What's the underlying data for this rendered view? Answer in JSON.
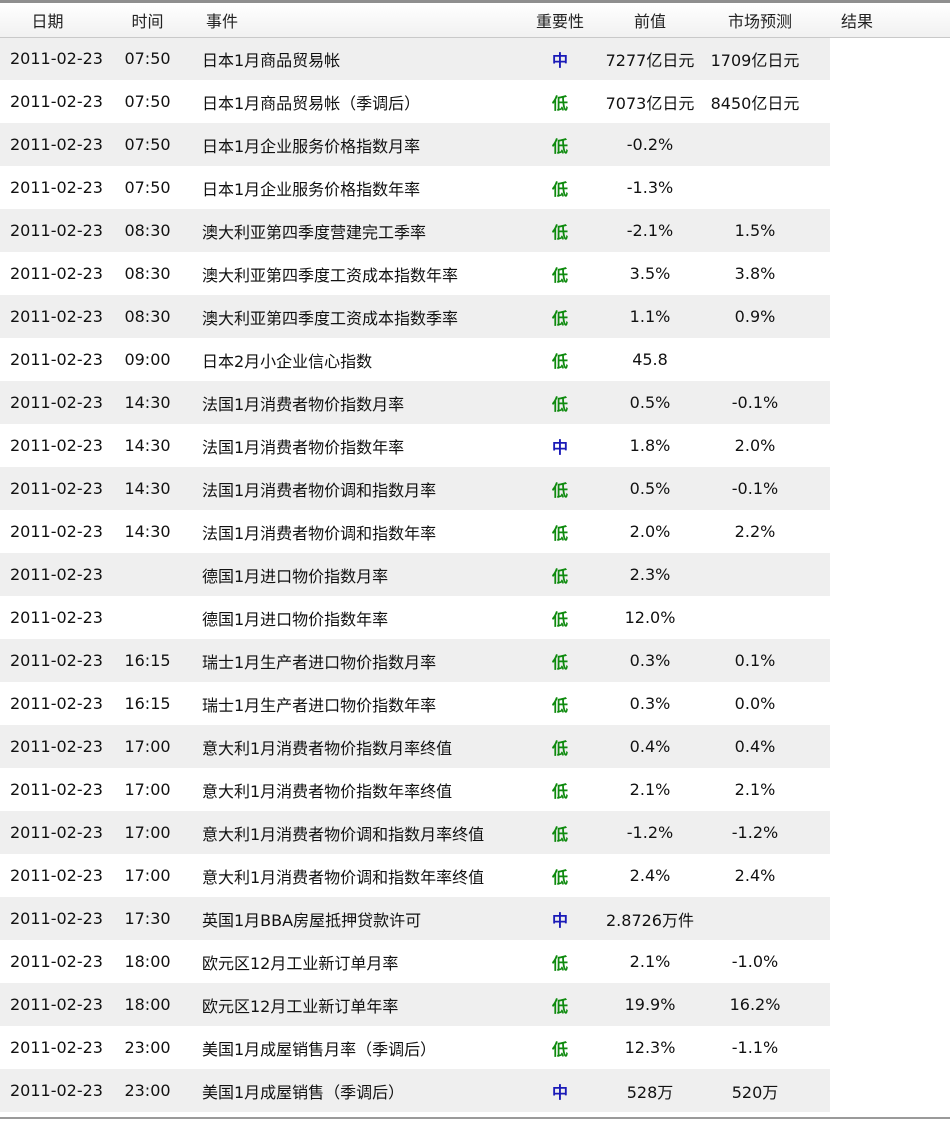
{
  "header": {
    "date": "日期",
    "time": "时间",
    "event": "事件",
    "importance": "重要性",
    "previous": "前值",
    "forecast": "市场预测",
    "result": "结果"
  },
  "colors": {
    "importance_mid": "#1a1ab8",
    "importance_low": "#0e8a0e",
    "row_shade": "#efefef"
  },
  "rows": [
    {
      "date": "2011-02-23",
      "time": "07:50",
      "event": "日本1月商品贸易帐",
      "importance": "中",
      "previous": "7277亿日元",
      "forecast": "1709亿日元",
      "result": ""
    },
    {
      "date": "2011-02-23",
      "time": "07:50",
      "event": "日本1月商品贸易帐（季调后）",
      "importance": "低",
      "previous": "7073亿日元",
      "forecast": "8450亿日元",
      "result": ""
    },
    {
      "date": "2011-02-23",
      "time": "07:50",
      "event": "日本1月企业服务价格指数月率",
      "importance": "低",
      "previous": "-0.2%",
      "forecast": "",
      "result": ""
    },
    {
      "date": "2011-02-23",
      "time": "07:50",
      "event": "日本1月企业服务价格指数年率",
      "importance": "低",
      "previous": "-1.3%",
      "forecast": "",
      "result": ""
    },
    {
      "date": "2011-02-23",
      "time": "08:30",
      "event": "澳大利亚第四季度营建完工季率",
      "importance": "低",
      "previous": "-2.1%",
      "forecast": "1.5%",
      "result": ""
    },
    {
      "date": "2011-02-23",
      "time": "08:30",
      "event": "澳大利亚第四季度工资成本指数年率",
      "importance": "低",
      "previous": "3.5%",
      "forecast": "3.8%",
      "result": ""
    },
    {
      "date": "2011-02-23",
      "time": "08:30",
      "event": "澳大利亚第四季度工资成本指数季率",
      "importance": "低",
      "previous": "1.1%",
      "forecast": "0.9%",
      "result": ""
    },
    {
      "date": "2011-02-23",
      "time": "09:00",
      "event": "日本2月小企业信心指数",
      "importance": "低",
      "previous": "45.8",
      "forecast": "",
      "result": ""
    },
    {
      "date": "2011-02-23",
      "time": "14:30",
      "event": "法国1月消费者物价指数月率",
      "importance": "低",
      "previous": "0.5%",
      "forecast": "-0.1%",
      "result": ""
    },
    {
      "date": "2011-02-23",
      "time": "14:30",
      "event": "法国1月消费者物价指数年率",
      "importance": "中",
      "previous": "1.8%",
      "forecast": "2.0%",
      "result": ""
    },
    {
      "date": "2011-02-23",
      "time": "14:30",
      "event": "法国1月消费者物价调和指数月率",
      "importance": "低",
      "previous": "0.5%",
      "forecast": "-0.1%",
      "result": ""
    },
    {
      "date": "2011-02-23",
      "time": "14:30",
      "event": "法国1月消费者物价调和指数年率",
      "importance": "低",
      "previous": "2.0%",
      "forecast": "2.2%",
      "result": ""
    },
    {
      "date": "2011-02-23",
      "time": "",
      "event": "德国1月进口物价指数月率",
      "importance": "低",
      "previous": "2.3%",
      "forecast": "",
      "result": ""
    },
    {
      "date": "2011-02-23",
      "time": "",
      "event": "德国1月进口物价指数年率",
      "importance": "低",
      "previous": "12.0%",
      "forecast": "",
      "result": ""
    },
    {
      "date": "2011-02-23",
      "time": "16:15",
      "event": "瑞士1月生产者进口物价指数月率",
      "importance": "低",
      "previous": "0.3%",
      "forecast": "0.1%",
      "result": ""
    },
    {
      "date": "2011-02-23",
      "time": "16:15",
      "event": "瑞士1月生产者进口物价指数年率",
      "importance": "低",
      "previous": "0.3%",
      "forecast": "0.0%",
      "result": ""
    },
    {
      "date": "2011-02-23",
      "time": "17:00",
      "event": "意大利1月消费者物价指数月率终值",
      "importance": "低",
      "previous": "0.4%",
      "forecast": "0.4%",
      "result": ""
    },
    {
      "date": "2011-02-23",
      "time": "17:00",
      "event": "意大利1月消费者物价指数年率终值",
      "importance": "低",
      "previous": "2.1%",
      "forecast": "2.1%",
      "result": ""
    },
    {
      "date": "2011-02-23",
      "time": "17:00",
      "event": "意大利1月消费者物价调和指数月率终值",
      "importance": "低",
      "previous": "-1.2%",
      "forecast": "-1.2%",
      "result": ""
    },
    {
      "date": "2011-02-23",
      "time": "17:00",
      "event": "意大利1月消费者物价调和指数年率终值",
      "importance": "低",
      "previous": "2.4%",
      "forecast": "2.4%",
      "result": ""
    },
    {
      "date": "2011-02-23",
      "time": "17:30",
      "event": "英国1月BBA房屋抵押贷款许可",
      "importance": "中",
      "previous": "2.8726万件",
      "forecast": "",
      "result": ""
    },
    {
      "date": "2011-02-23",
      "time": "18:00",
      "event": "欧元区12月工业新订单月率",
      "importance": "低",
      "previous": "2.1%",
      "forecast": "-1.0%",
      "result": ""
    },
    {
      "date": "2011-02-23",
      "time": "18:00",
      "event": "欧元区12月工业新订单年率",
      "importance": "低",
      "previous": "19.9%",
      "forecast": "16.2%",
      "result": ""
    },
    {
      "date": "2011-02-23",
      "time": "23:00",
      "event": "美国1月成屋销售月率（季调后）",
      "importance": "低",
      "previous": "12.3%",
      "forecast": "-1.1%",
      "result": ""
    },
    {
      "date": "2011-02-23",
      "time": "23:00",
      "event": "美国1月成屋销售（季调后）",
      "importance": "中",
      "previous": "528万",
      "forecast": "520万",
      "result": ""
    }
  ]
}
